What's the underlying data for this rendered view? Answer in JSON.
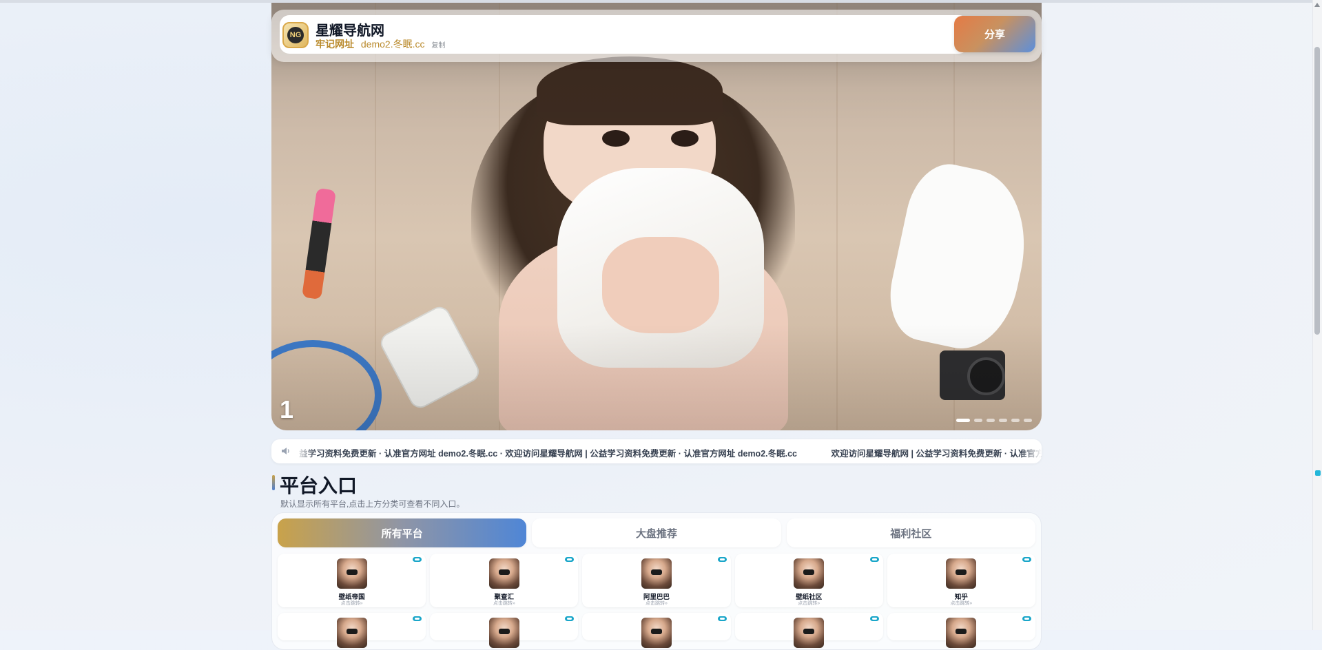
{
  "header": {
    "site_title": "星耀导航网",
    "sub_label": "牢记网址",
    "domain": "demo2.冬眠.cc",
    "copy_label": "复制",
    "share_label": "分享",
    "logo_text": "NG"
  },
  "hero": {
    "slide_number": "1",
    "dot_count": 6,
    "active_dot": 1
  },
  "marquee": {
    "items": [
      "益学习资料免费更新 · 认准官方网址 demo2.冬眠.cc · 欢迎访问星耀导航网 | 公益学习资料免费更新 · 认准官方网址 demo2.冬眠.cc",
      "欢迎访问星耀导航网 | 公益学习资料免费更新 · 认准官方"
    ]
  },
  "section": {
    "title": "平台入口",
    "description": "默认显示所有平台,点击上方分类可查看不同入口。"
  },
  "tabs": [
    {
      "label": "所有平台"
    },
    {
      "label": "大盘推荐"
    },
    {
      "label": "福利社区"
    }
  ],
  "cards": [
    {
      "name": "壁纸帝国",
      "hint": "点击跳转»"
    },
    {
      "name": "聚查汇",
      "hint": "点击跳转»"
    },
    {
      "name": "阿里巴巴",
      "hint": "点击跳转»"
    },
    {
      "name": "壁纸社区",
      "hint": "点击跳转»"
    },
    {
      "name": "知乎",
      "hint": "点击跳转»"
    }
  ],
  "colors": {
    "accent_gold": "#c9a24a",
    "accent_blue": "#4f86d6",
    "badge": "#1aa6c9"
  },
  "icons": {
    "speaker": "speaker-icon",
    "badge": "eye-icon"
  }
}
